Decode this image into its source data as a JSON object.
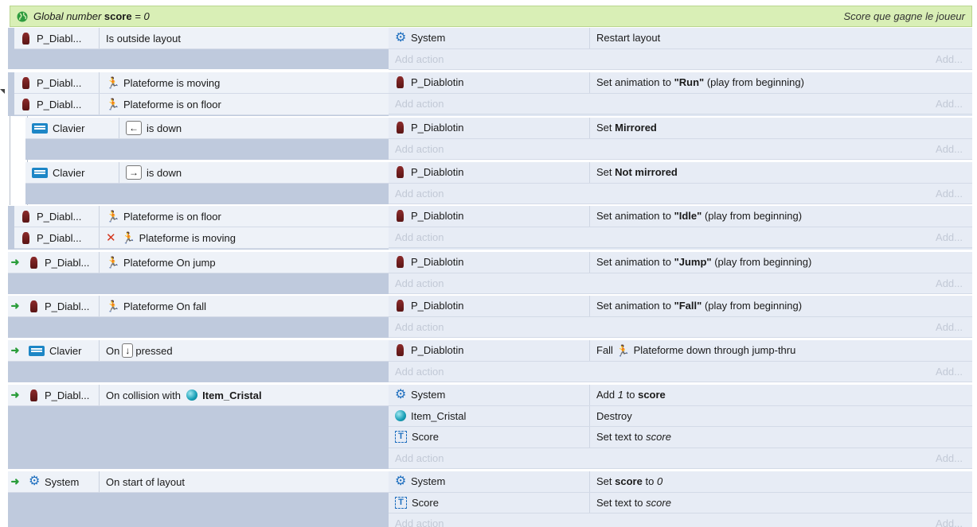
{
  "global_var": {
    "label_prefix": "Global number",
    "name": "score",
    "value_text": "= 0",
    "comment": "Score que gagne le joueur"
  },
  "common": {
    "add_action": "Add action",
    "add": "Add..."
  },
  "events": [
    {
      "conditions": [
        {
          "object": "P_Diabl...",
          "text": "Is outside layout"
        }
      ],
      "actions": [
        {
          "object": "System",
          "text": "Restart layout"
        }
      ]
    },
    {
      "conditions": [
        {
          "object": "P_Diabl...",
          "text": "Plateforme is moving"
        },
        {
          "object": "P_Diabl...",
          "text": "Plateforme is on floor"
        }
      ],
      "actions": [
        {
          "object": "P_Diablotin",
          "text_pre": "Set animation to",
          "text_bold": "\"Run\"",
          "text_post": "(play from beginning)"
        }
      ]
    },
    {
      "conditions": [
        {
          "object": "Clavier",
          "key": "←",
          "text": "is down"
        }
      ],
      "actions": [
        {
          "object": "P_Diablotin",
          "text_pre": "Set",
          "text_bold": "Mirrored"
        }
      ]
    },
    {
      "conditions": [
        {
          "object": "Clavier",
          "key": "→",
          "text": "is down"
        }
      ],
      "actions": [
        {
          "object": "P_Diablotin",
          "text_pre": "Set",
          "text_bold": "Not mirrored"
        }
      ]
    },
    {
      "conditions": [
        {
          "object": "P_Diabl...",
          "text": "Plateforme is on floor"
        },
        {
          "object": "P_Diabl...",
          "text": "Plateforme is moving",
          "inverted_mark": "✕"
        }
      ],
      "actions": [
        {
          "object": "P_Diablotin",
          "text_pre": "Set animation to",
          "text_bold": "\"Idle\"",
          "text_post": "(play from beginning)"
        }
      ]
    },
    {
      "trigger": "➜",
      "conditions": [
        {
          "object": "P_Diabl...",
          "text": "Plateforme On jump"
        }
      ],
      "actions": [
        {
          "object": "P_Diablotin",
          "text_pre": "Set animation to",
          "text_bold": "\"Jump\"",
          "text_post": "(play from beginning)"
        }
      ]
    },
    {
      "trigger": "➜",
      "conditions": [
        {
          "object": "P_Diabl...",
          "text": "Plateforme On fall"
        }
      ],
      "actions": [
        {
          "object": "P_Diablotin",
          "text_pre": "Set animation to",
          "text_bold": "\"Fall\"",
          "text_post": "(play from beginning)"
        }
      ]
    },
    {
      "trigger": "➜",
      "conditions": [
        {
          "object": "Clavier",
          "text_pre": "On",
          "key": "↓",
          "text": "pressed"
        }
      ],
      "actions": [
        {
          "object": "P_Diablotin",
          "text_pre": "Fall",
          "text": "Plateforme down through jump-thru"
        }
      ]
    },
    {
      "trigger": "➜",
      "conditions": [
        {
          "object": "P_Diabl...",
          "text_pre": "On collision with",
          "text_bold": "Item_Cristal"
        }
      ],
      "actions": [
        {
          "object": "System",
          "text_pre": "Add",
          "text_italic": "1",
          "text_mid": "to",
          "text_bold": "score"
        },
        {
          "object": "Item_Cristal",
          "text": "Destroy"
        },
        {
          "object": "Score",
          "text_pre": "Set text to",
          "text_italic": "score"
        }
      ]
    },
    {
      "trigger": "➜",
      "conditions": [
        {
          "object": "System",
          "text": "On start of layout"
        }
      ],
      "actions": [
        {
          "object": "System",
          "text_pre": "Set",
          "text_bold": "score",
          "text_mid": "to",
          "text_italic": "0"
        },
        {
          "object": "Score",
          "text_pre": "Set text to",
          "text_italic": "score"
        }
      ]
    }
  ]
}
